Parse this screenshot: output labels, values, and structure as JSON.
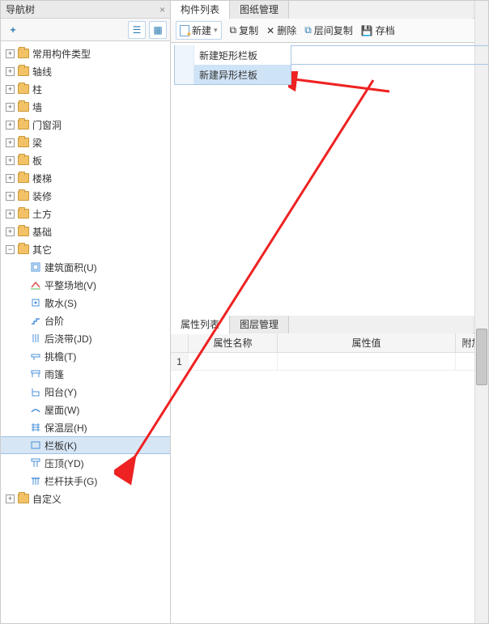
{
  "left_panel": {
    "title": "导航树"
  },
  "toolbar_left": {
    "add": "+"
  },
  "tree": {
    "top": [
      {
        "label": "常用构件类型"
      },
      {
        "label": "轴线"
      },
      {
        "label": "柱"
      },
      {
        "label": "墙"
      },
      {
        "label": "门窗洞"
      },
      {
        "label": "梁"
      },
      {
        "label": "板"
      },
      {
        "label": "楼梯"
      },
      {
        "label": "装修"
      },
      {
        "label": "土方"
      },
      {
        "label": "基础"
      }
    ],
    "other_label": "其它",
    "children": [
      {
        "label": "建筑面积(U)"
      },
      {
        "label": "平整场地(V)"
      },
      {
        "label": "散水(S)"
      },
      {
        "label": "台阶"
      },
      {
        "label": "后浇带(JD)"
      },
      {
        "label": "挑檐(T)"
      },
      {
        "label": "雨篷"
      },
      {
        "label": "阳台(Y)"
      },
      {
        "label": "屋面(W)"
      },
      {
        "label": "保温层(H)"
      },
      {
        "label": "栏板(K)"
      },
      {
        "label": "压顶(YD)"
      },
      {
        "label": "栏杆扶手(G)"
      }
    ],
    "custom": "自定义"
  },
  "right_panel": {
    "tabs": {
      "components": "构件列表",
      "drawing": "图纸管理"
    },
    "toolbar": {
      "new": "新建",
      "copy": "复制",
      "del": "删除",
      "floorcopy": "层间复制",
      "archive": "存档"
    },
    "dropdown": {
      "rect": "新建矩形栏板",
      "irr": "新建异形栏板"
    }
  },
  "prop_panel": {
    "tabs": {
      "props": "属性列表",
      "layer": "图层管理"
    },
    "cols": {
      "name": "属性名称",
      "val": "属性值",
      "add": "附加"
    },
    "row1": "1"
  }
}
